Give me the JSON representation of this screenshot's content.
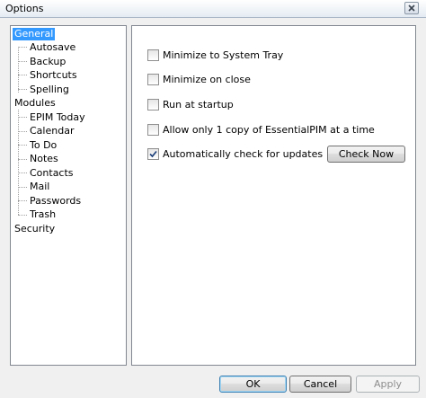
{
  "window": {
    "title": "Options"
  },
  "tree": {
    "items": [
      {
        "label": "General",
        "level": 0,
        "selected": true
      },
      {
        "label": "Autosave",
        "level": 1
      },
      {
        "label": "Backup",
        "level": 1
      },
      {
        "label": "Shortcuts",
        "level": 1
      },
      {
        "label": "Spelling",
        "level": 1
      },
      {
        "label": "Modules",
        "level": 0
      },
      {
        "label": "EPIM Today",
        "level": 1
      },
      {
        "label": "Calendar",
        "level": 1
      },
      {
        "label": "To Do",
        "level": 1
      },
      {
        "label": "Notes",
        "level": 1
      },
      {
        "label": "Contacts",
        "level": 1
      },
      {
        "label": "Mail",
        "level": 1
      },
      {
        "label": "Passwords",
        "level": 1
      },
      {
        "label": "Trash",
        "level": 1
      },
      {
        "label": "Security",
        "level": 0
      }
    ]
  },
  "options": [
    {
      "label": "Minimize to System Tray",
      "checked": false
    },
    {
      "label": "Minimize on close",
      "checked": false
    },
    {
      "label": "Run at startup",
      "checked": false
    },
    {
      "label": "Allow only 1 copy of EssentialPIM at a time",
      "checked": false
    },
    {
      "label": "Automatically check for updates",
      "checked": true
    }
  ],
  "buttons": {
    "check_now": "Check Now",
    "ok": "OK",
    "cancel": "Cancel",
    "apply": "Apply"
  },
  "icons": {
    "close": "close-icon",
    "checkmark": "checkmark-icon"
  },
  "colors": {
    "selection": "#3399ff",
    "default_button_border": "#3c7fb1"
  }
}
